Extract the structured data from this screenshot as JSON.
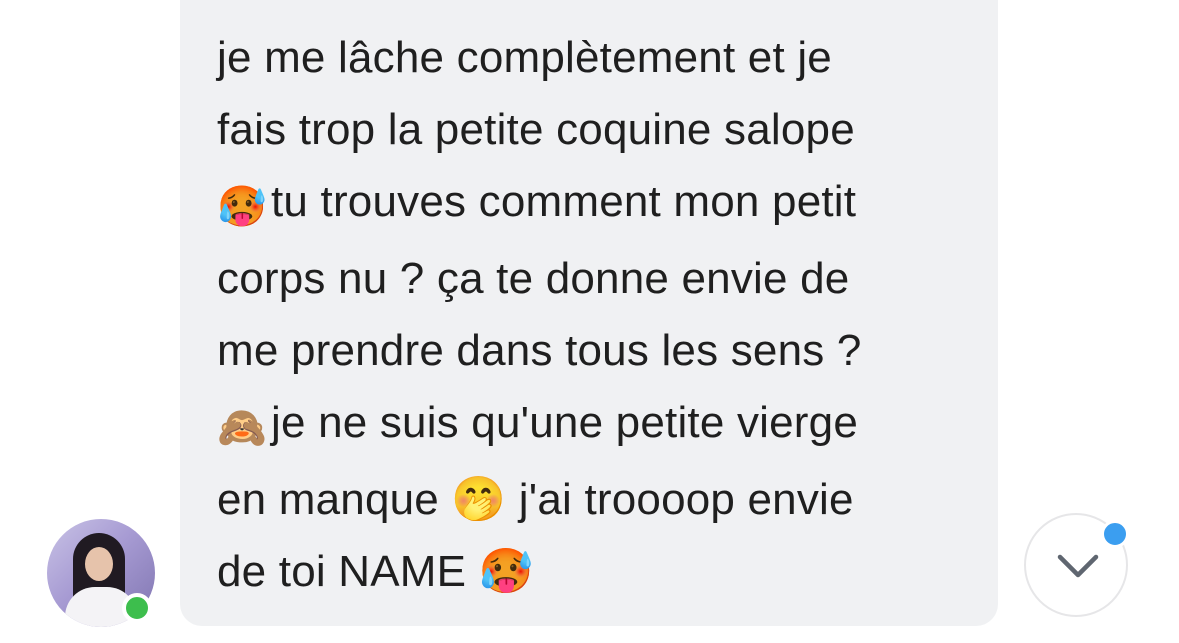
{
  "message": {
    "lines": [
      {
        "emoji": "",
        "text": "je me lâche complètement et je"
      },
      {
        "emoji": "",
        "text": "fais trop la petite coquine salope"
      },
      {
        "emoji": "🥵",
        "text": "tu trouves comment mon petit"
      },
      {
        "emoji": "",
        "text": "corps nu ? ça te donne envie de"
      },
      {
        "emoji": "",
        "text": "me prendre dans tous les sens ?"
      },
      {
        "emoji": "🙈",
        "text": "je ne suis qu'une petite vierge"
      },
      {
        "emoji": "",
        "text": "en manque 🤭 j'ai troooop envie"
      },
      {
        "emoji": "",
        "text": "de toi NAME 🥵"
      }
    ],
    "bubble_color": "#f0f1f3",
    "text_color": "#1f1f1f"
  },
  "sender": {
    "avatar_icon": "avatar",
    "status": "online",
    "status_color": "#3dbe4d"
  },
  "scroll_button": {
    "icon": "chevron-down-icon",
    "notification_color": "#3b9ef0"
  }
}
